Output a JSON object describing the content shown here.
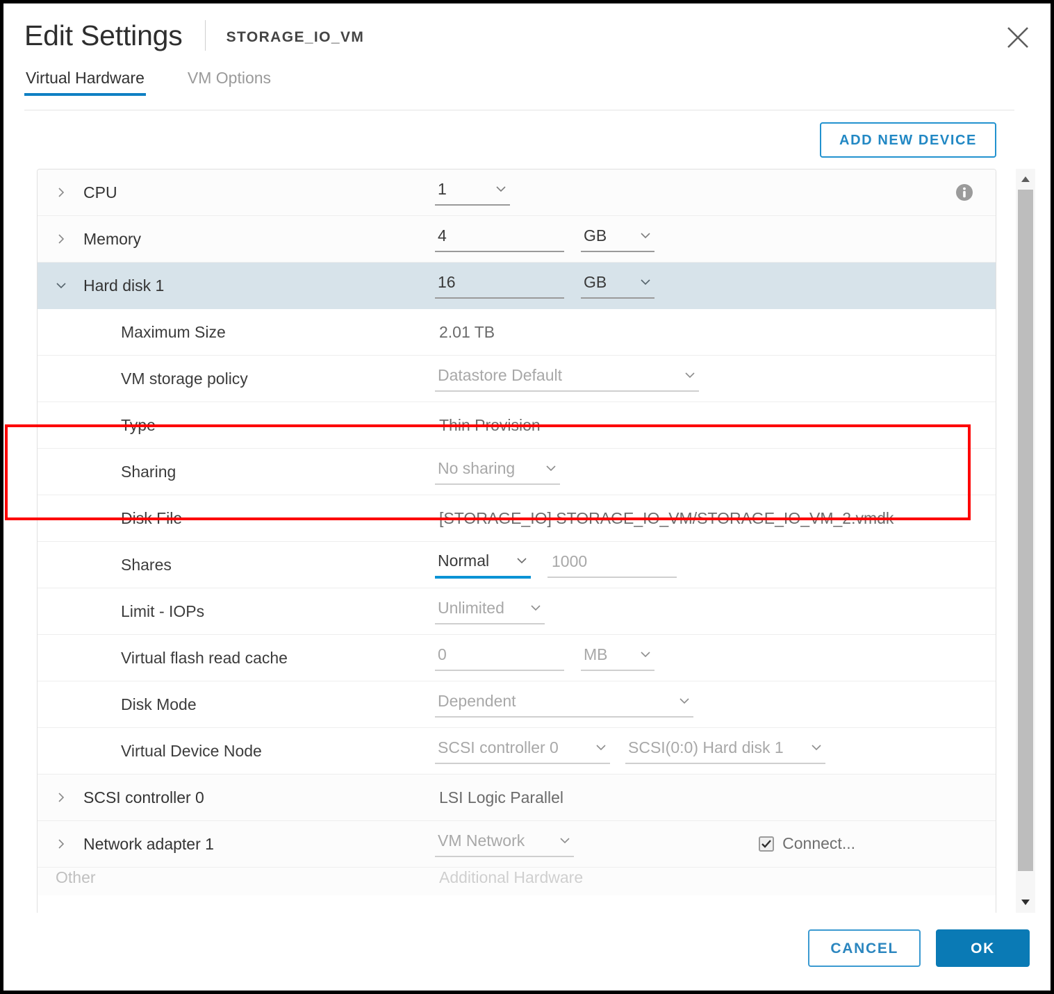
{
  "window": {
    "title": "Edit Settings",
    "subtitle": "STORAGE_IO_VM",
    "close_icon": "close-icon"
  },
  "tabs": [
    {
      "label": "Virtual Hardware",
      "active": true
    },
    {
      "label": "VM Options",
      "active": false
    }
  ],
  "toolbar": {
    "add_new_device_label": "ADD NEW DEVICE"
  },
  "colors": {
    "accent_blue": "#0f80c3",
    "primary_button": "#0a7ab5",
    "focus_underline": "#0b93d5",
    "selected_row": "#d7e3ea",
    "annotation_red": "#fd0000"
  },
  "devices": {
    "cpu": {
      "label": "CPU",
      "value": "1",
      "expanded": false,
      "info_icon": "info-icon"
    },
    "memory": {
      "label": "Memory",
      "value": "4",
      "unit": "GB",
      "expanded": false
    },
    "hard_disk": {
      "label": "Hard disk 1",
      "value": "16",
      "unit": "GB",
      "expanded": true,
      "selected": true,
      "details": [
        {
          "label": "Maximum Size",
          "value": "2.01 TB",
          "kind": "text"
        },
        {
          "label": "VM storage policy",
          "value": "Datastore Default",
          "kind": "select"
        },
        {
          "label": "Type",
          "value": "Thin Provision",
          "kind": "text"
        },
        {
          "label": "Sharing",
          "value": "No sharing",
          "kind": "select"
        },
        {
          "label": "Disk File",
          "value": "[STORAGE_IO] STORAGE_IO_VM/STORAGE_IO_VM_2.vmdk",
          "kind": "text"
        }
      ],
      "shares": {
        "label": "Shares",
        "level": "Normal",
        "value": "1000",
        "focused": true
      },
      "limit_iops": {
        "label": "Limit - IOPs",
        "value": "Unlimited"
      },
      "details_after": [
        {
          "label": "Virtual flash read cache",
          "value": "0",
          "unit": "MB",
          "kind": "input-unit"
        },
        {
          "label": "Disk Mode",
          "value": "Dependent",
          "kind": "select"
        }
      ],
      "virtual_device_node": {
        "label": "Virtual Device Node",
        "controller": "SCSI controller 0",
        "node": "SCSI(0:0) Hard disk 1"
      }
    },
    "scsi_controller": {
      "label": "SCSI controller 0",
      "value": "LSI Logic Parallel",
      "expanded": false
    },
    "network_adapter": {
      "label": "Network adapter 1",
      "value": "VM Network",
      "connect_label": "Connect...",
      "connected": true,
      "expanded": false
    },
    "clipped_row": {
      "label": "Other",
      "value": "Additional Hardware"
    }
  },
  "footer": {
    "cancel_label": "CANCEL",
    "ok_label": "OK"
  }
}
